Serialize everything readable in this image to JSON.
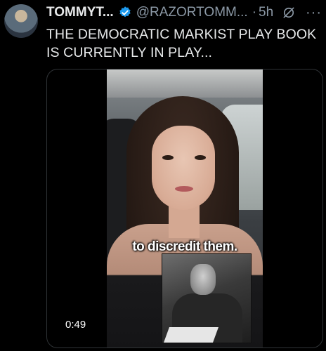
{
  "tweet": {
    "display_name": "TOMMYT...",
    "handle": "@RAZORTOMM...",
    "separator": "·",
    "time": "5h",
    "more_label": "···",
    "text": "THE DEMOCRATIC MARKIST PLAY BOOK IS CURRENTLY IN PLAY...",
    "icons": {
      "verified": "verified-badge-icon",
      "grok": "grok-icon",
      "more": "more-options-icon"
    },
    "colors": {
      "verified": "#1d9bf0",
      "secondary_text": "#8b98a5"
    }
  },
  "media": {
    "caption": "to discredit them.",
    "duration": "0:49"
  }
}
